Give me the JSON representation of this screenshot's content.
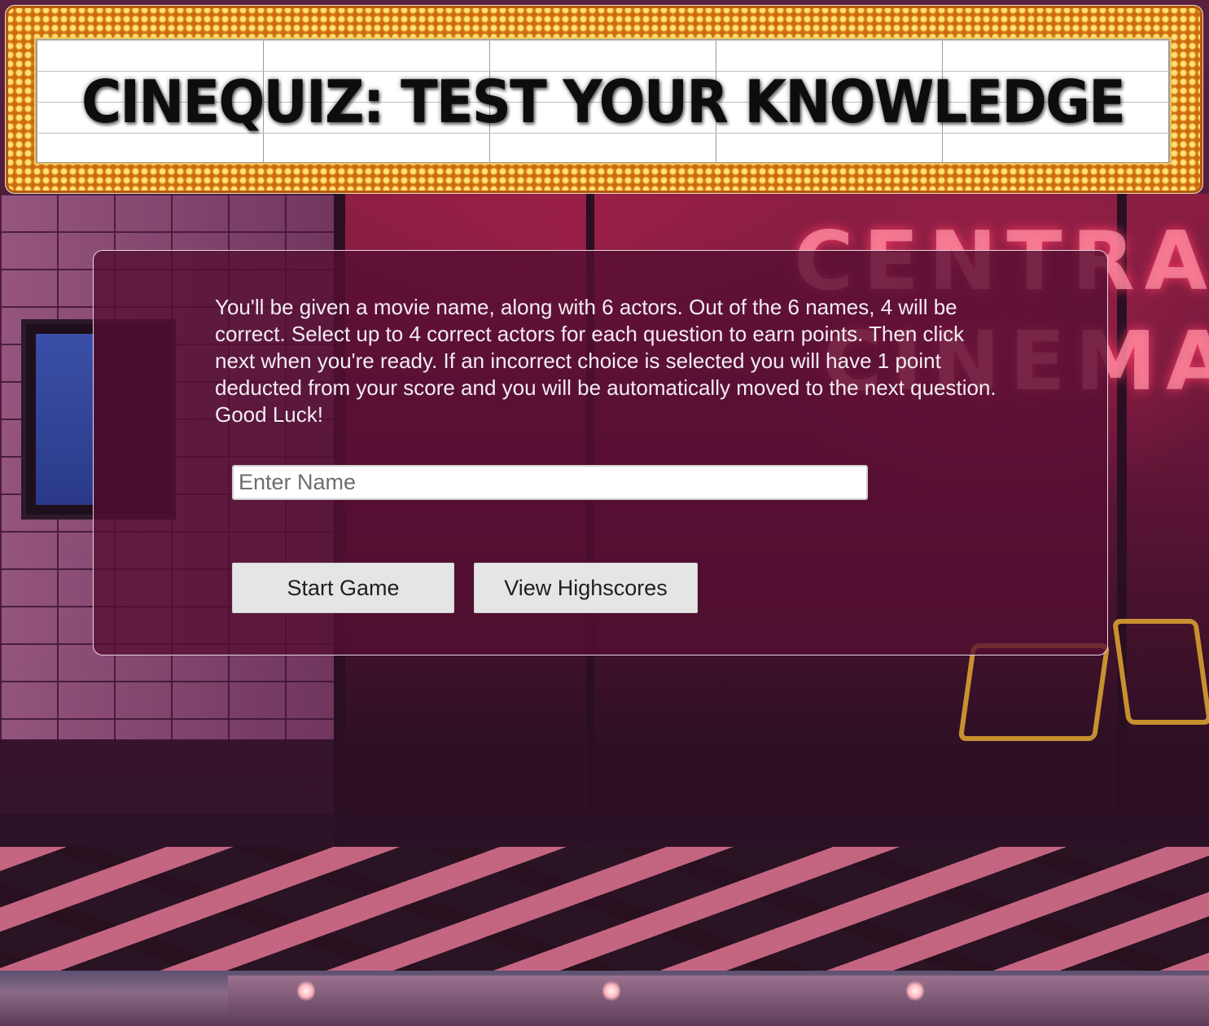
{
  "header": {
    "title": "CINEQUIZ: TEST YOUR KNOWLEDGE"
  },
  "panel": {
    "instructions": "You'll be given a movie name, along with 6 actors. Out of the 6 names, 4 will be correct. Select up to 4 correct actors for each question to earn points. Then click next when you're ready. If an incorrect choice is selected you will have 1 point deducted from your score and you will be automatically moved to the next question. Good Luck!",
    "name_input": {
      "placeholder": "Enter Name",
      "value": ""
    },
    "start_button_label": "Start Game",
    "highscores_button_label": "View Highscores"
  },
  "background": {
    "neon_sign_line1": "CENTRAL",
    "neon_sign_line2": "CINEMA"
  },
  "colors": {
    "marquee_bulbs": "#ffd24d",
    "marquee_frame": "#c96b12",
    "panel_bg": "#550e32",
    "button_bg": "#e5e5e5"
  }
}
